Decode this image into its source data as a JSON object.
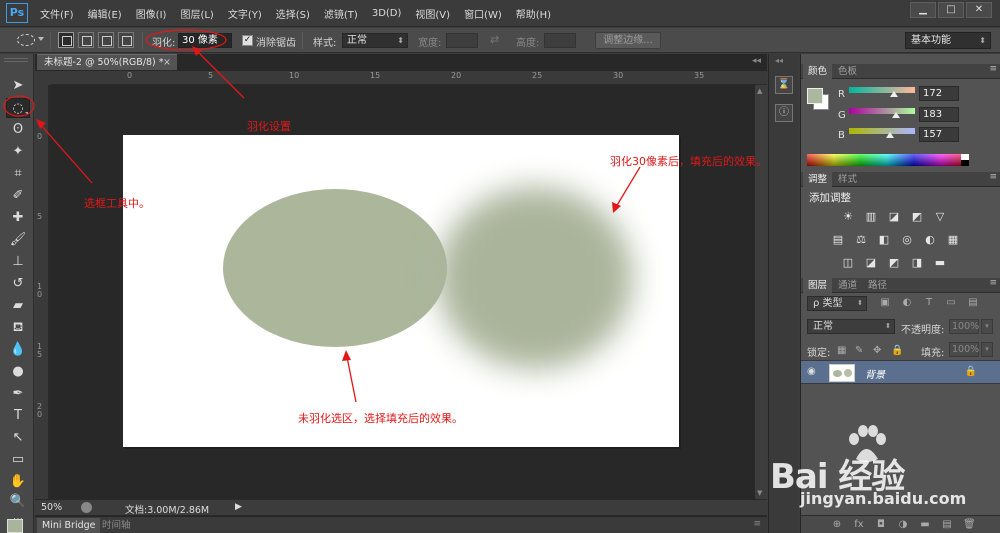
{
  "app": {
    "logo": "Ps",
    "menu": [
      "文件(F)",
      "编辑(E)",
      "图像(I)",
      "图层(L)",
      "文字(Y)",
      "选择(S)",
      "滤镜(T)",
      "3D(D)",
      "视图(V)",
      "窗口(W)",
      "帮助(H)"
    ],
    "window_buttons": [
      "▁",
      "□",
      "✕"
    ]
  },
  "options": {
    "feather_label": "羽化:",
    "feather_value": "30 像素",
    "antialias_label": "消除锯齿",
    "antialias_checked": "✓",
    "style_label": "样式:",
    "style_value": "正常",
    "width_label": "宽度:",
    "height_label": "高度:",
    "refine_edge": "调整边缘...",
    "workspace": "基本功能"
  },
  "document": {
    "tab_title": "未标题-2 @ 50%(RGB/8) *",
    "tab_close": "×",
    "zoom": "50%",
    "doc_size": "文档:3.00M/2.86M",
    "ruler_h": [
      "0",
      "5",
      "10",
      "15",
      "20",
      "25",
      "30",
      "35"
    ],
    "ruler_v": [
      "0",
      "5",
      "10",
      "15",
      "20"
    ],
    "shape_color": "#abb69b"
  },
  "bottom_tabs": [
    "Mini Bridge",
    "时间轴"
  ],
  "annotations": {
    "feather_setting": "羽化设置",
    "marquee_tool": "选框工具中。",
    "feathered_result": "羽化30像素后，填充后的效果。",
    "unfeathered_result": "未羽化选区，选择填充后的效果。"
  },
  "color_panel": {
    "tabs": [
      "颜色",
      "色板"
    ],
    "r_label": "R",
    "r_value": "172",
    "g_label": "G",
    "g_value": "183",
    "b_label": "B",
    "b_value": "157",
    "foreground": "#acb79d",
    "channel_levels": {
      "r": 172,
      "g": 183,
      "b": 157
    }
  },
  "adjust_panel": {
    "tabs": [
      "调整",
      "样式"
    ],
    "title": "添加调整",
    "row1": [
      "☀",
      "▥",
      "◪",
      "◩",
      "▽"
    ],
    "row2": [
      "▤",
      "⚖",
      "◧",
      "◎",
      "◐",
      "▦"
    ],
    "row3": [
      "◫",
      "◪",
      "◩",
      "◨",
      "▬"
    ]
  },
  "layers_panel": {
    "tabs": [
      "图层",
      "通道",
      "路径"
    ],
    "filter": "ρ 类型",
    "filter_icons": [
      "▣",
      "◐",
      "T",
      "▭",
      "▤"
    ],
    "blend_mode": "正常",
    "opacity_label": "不透明度:",
    "opacity_value": "100%",
    "lock_label": "锁定:",
    "lock_icons": [
      "▦",
      "✎",
      "✥",
      "🔒"
    ],
    "fill_label": "填充:",
    "fill_value": "100%",
    "layer_name": "背景",
    "eye": "◉",
    "layer_lock": "🔒",
    "footer_icons": [
      "⊕",
      "fx",
      "◘",
      "◑",
      "▬",
      "▤",
      "🗑"
    ]
  },
  "watermark": {
    "brand": "Bai  经验",
    "url": "jingyan.baidu.com"
  }
}
